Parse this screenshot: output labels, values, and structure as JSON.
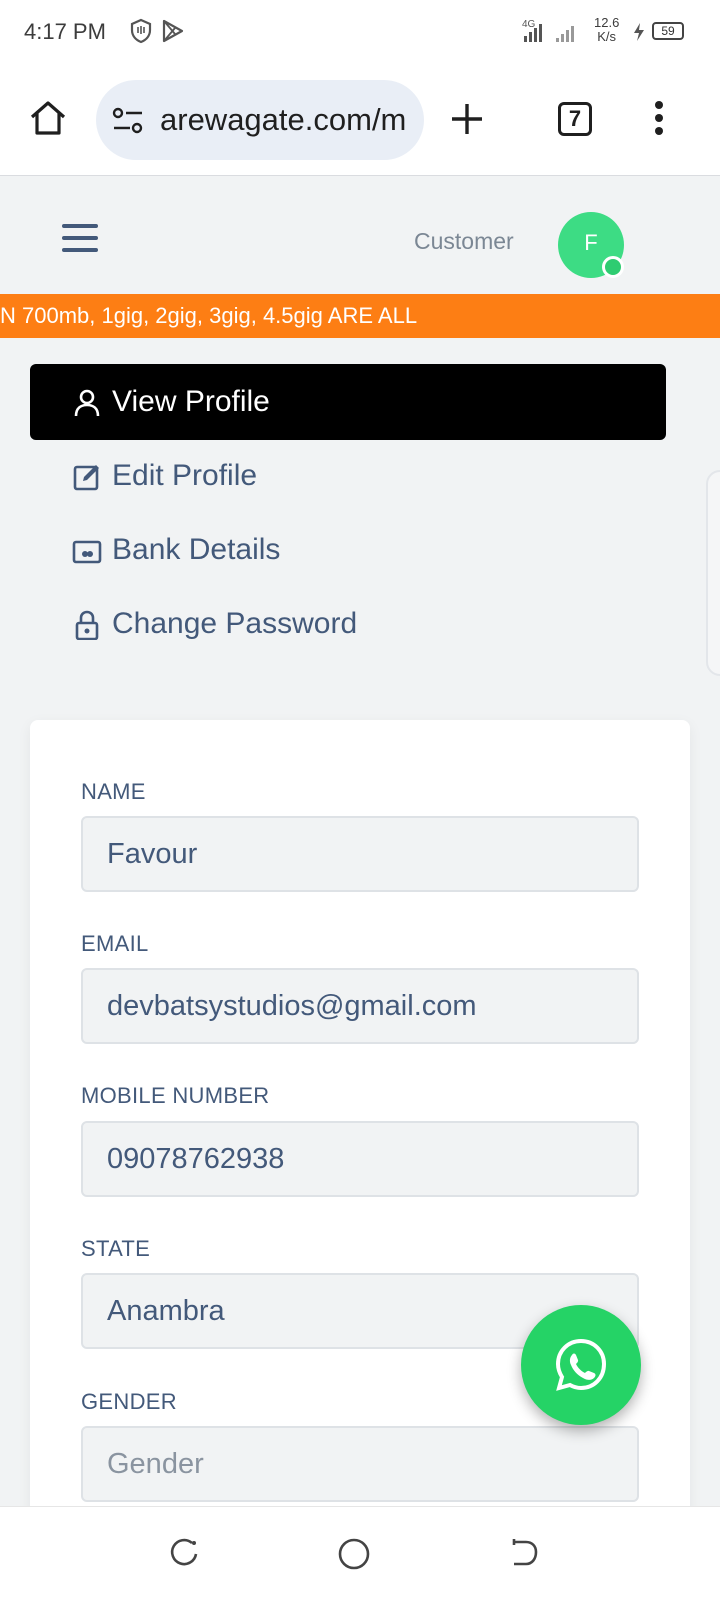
{
  "status_bar": {
    "time": "4:17 PM",
    "network": "4G",
    "speed_value": "12.6",
    "speed_unit": "K/s",
    "battery": "59",
    "icons": [
      "shield-icon",
      "play-store-icon",
      "signal-icon",
      "charging-icon",
      "battery-icon"
    ]
  },
  "browser": {
    "url": "arewagate.com/m",
    "tab_count": "7",
    "icons": [
      "home-icon",
      "site-settings-icon",
      "new-tab-icon",
      "more-vert-icon"
    ]
  },
  "header": {
    "role": "Customer",
    "avatar_initial": "F",
    "avatar_color": "#3ddc84",
    "online_color": "#2ecc71"
  },
  "marquee": {
    "text": "N 700mb, 1gig, 2gig, 3gig, 4.5gig ARE ALL",
    "bg_color": "#fd7e14"
  },
  "menu": {
    "items": [
      {
        "label": "View Profile",
        "icon": "user-icon",
        "active": true
      },
      {
        "label": "Edit Profile",
        "icon": "edit-icon",
        "active": false
      },
      {
        "label": "Bank Details",
        "icon": "bank-card-icon",
        "active": false
      },
      {
        "label": "Change Password",
        "icon": "lock-icon",
        "active": false
      }
    ]
  },
  "form": {
    "fields": [
      {
        "label": "NAME",
        "value": "Favour"
      },
      {
        "label": "EMAIL",
        "value": "devbatsystudios@gmail.com"
      },
      {
        "label": "MOBILE NUMBER",
        "value": "09078762938"
      },
      {
        "label": "STATE",
        "value": "Anambra"
      },
      {
        "label": "GENDER",
        "value": "",
        "placeholder": "Gender"
      }
    ]
  },
  "whatsapp": {
    "icon": "whatsapp-icon",
    "color": "#25d366"
  },
  "nav_bar": {
    "icons": [
      "recents-icon",
      "home-circle-icon",
      "back-icon"
    ]
  }
}
